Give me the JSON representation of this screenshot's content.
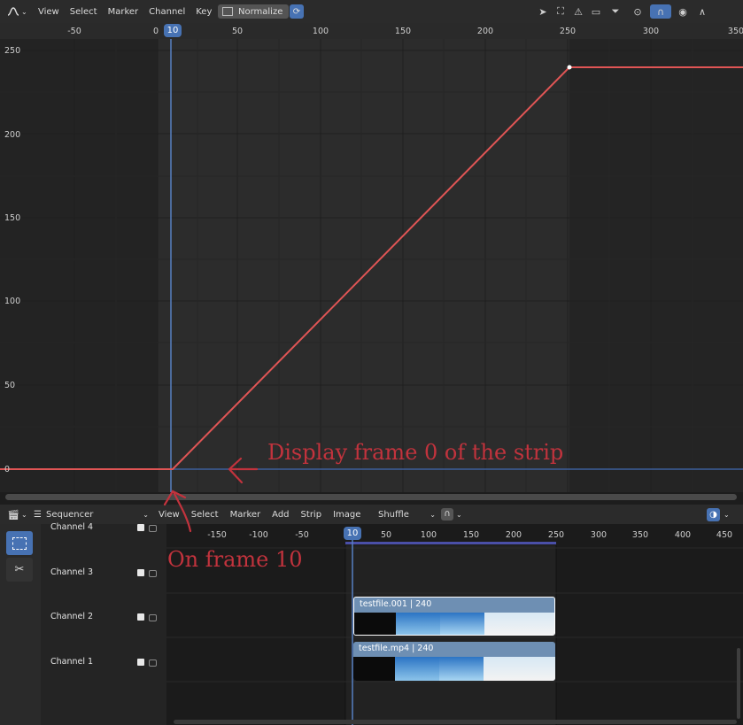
{
  "graph_header": {
    "menus": [
      "View",
      "Select",
      "Marker",
      "Channel",
      "Key"
    ],
    "normalize_label": "Normalize"
  },
  "graph_ruler": {
    "x_ticks": [
      "-50",
      "0",
      "50",
      "100",
      "150",
      "200",
      "250",
      "300",
      "350"
    ],
    "current_frame": "10"
  },
  "graph_y_ticks": [
    "250",
    "200",
    "150",
    "100",
    "50",
    "0"
  ],
  "annotations": {
    "display_frame": "Display frame 0 of the strip",
    "on_frame": "On frame 10"
  },
  "sequencer_header": {
    "editor_label": "Sequencer",
    "menus": [
      "View",
      "Select",
      "Marker",
      "Add",
      "Strip",
      "Image"
    ],
    "shuffle_label": "Shuffle"
  },
  "sequencer_ruler": {
    "x_ticks": [
      "-150",
      "-100",
      "-50",
      "50",
      "100",
      "150",
      "200",
      "250",
      "300",
      "350",
      "400",
      "450"
    ],
    "current_frame": "10"
  },
  "channels": [
    {
      "label": "Channel 4"
    },
    {
      "label": "Channel 3"
    },
    {
      "label": "Channel 2"
    },
    {
      "label": "Channel 1"
    }
  ],
  "strips": [
    {
      "title": "testfile.001 | 240",
      "channel": 2
    },
    {
      "title": "testfile.mp4 | 240",
      "channel": 1
    }
  ],
  "colors": {
    "curve": "#e05555",
    "playhead": "#5680c2",
    "strip": "#6e8fb3",
    "annotation": "#c2333d"
  }
}
